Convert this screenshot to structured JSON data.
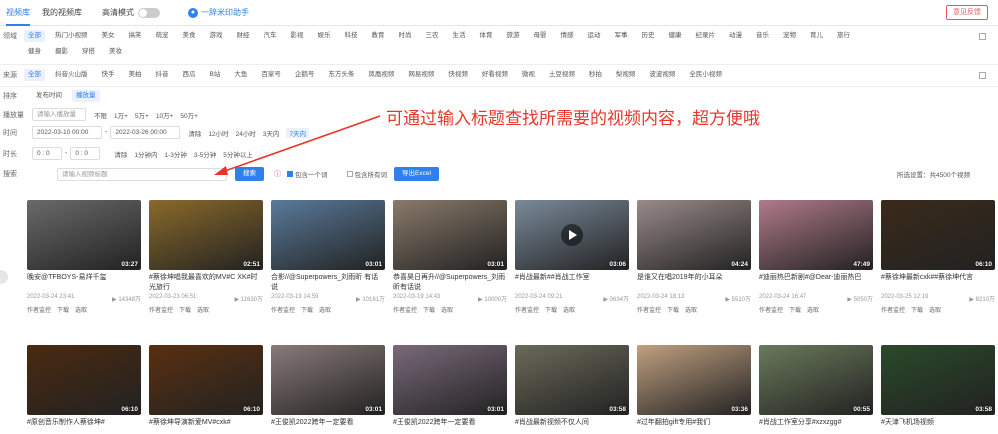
{
  "topbar": {
    "tabs": [
      "视频库",
      "我的视频库"
    ],
    "mode_label": "高清模式",
    "helper_label": "一辞米印助手",
    "feedback_label": "意见反馈"
  },
  "domain_row": {
    "label": "领域",
    "items": [
      "全部",
      "热门小视频",
      "美女",
      "搞笑",
      "萌宠",
      "美食",
      "游戏",
      "财经",
      "汽车",
      "影视",
      "娱乐",
      "科技",
      "教育",
      "时尚",
      "三农",
      "生活",
      "体育",
      "旅游",
      "母婴",
      "情感",
      "运动",
      "军事",
      "历史",
      "健康",
      "纪录片",
      "动漫",
      "音乐",
      "宠物",
      "育儿",
      "旅行"
    ]
  },
  "domain_row2": {
    "items": [
      "健身",
      "摄影",
      "穿搭",
      "美妆"
    ]
  },
  "source_row": {
    "label": "来源",
    "items": [
      "全部",
      "抖音火山版",
      "快手",
      "美拍",
      "抖音",
      "西瓜",
      "B站",
      "大鱼",
      "百家号",
      "企鹅号",
      "东方头条",
      "凤凰视频",
      "网易视频",
      "快视频",
      "好看视频",
      "微视",
      "土豆视频",
      "秒拍",
      "梨视频",
      "波波视频",
      "全民小视频"
    ]
  },
  "sort_row": {
    "label": "排序",
    "items": [
      "发布时间",
      "播放量"
    ]
  },
  "playcount_row": {
    "label": "播放量",
    "placeholder": "请输入播放量",
    "options": [
      "不限",
      "1万+",
      "5万+",
      "10万+",
      "50万+"
    ]
  },
  "time_row": {
    "label": "时间",
    "start": "2022-03-10 00:00",
    "end": "2022-03-26 00:00",
    "options": [
      "清除",
      "12小时",
      "24小时",
      "3天内",
      "7天内"
    ]
  },
  "duration_row": {
    "label": "时长",
    "start": "0 : 0",
    "end": "0 : 0",
    "options": [
      "清除",
      "1分钟内",
      "1-3分钟",
      "3-5分钟",
      "5分钟以上"
    ]
  },
  "search_row": {
    "label": "搜索",
    "placeholder": "请输入视频标题",
    "search_btn": "搜索",
    "opt1": "包含一个词",
    "opt2": "包含所有词",
    "export_btn": "导出Excel",
    "result_text": "所选设置：共4500个视频"
  },
  "callout": "可通过输入标题查找所需要的视频内容，超方便哦",
  "cards": [
    {
      "title": "晚安@TFBOYS-易烊千玺",
      "dur": "03:27",
      "plays": "14348万",
      "date": "2022-03-24 23:41",
      "bg": "#6a6a6a"
    },
    {
      "title": "#蔡徐坤唱我最喜欢的MV#C XK#时光旅行",
      "dur": "02:51",
      "plays": "11630万",
      "date": "2022-03-23 06:51",
      "bg": "#8a6a2a"
    },
    {
      "title": "合影//@Superpowers_刘雨昕 有话说",
      "dur": "03:01",
      "plays": "10181万",
      "date": "2022-03-19 14:59",
      "bg": "#5a7a9a"
    },
    {
      "title": "恭喜昊日再升//@Superpowers_刘雨昕有话说",
      "dur": "03:01",
      "plays": "10000万",
      "date": "2022-03-19 14:43",
      "bg": "#8a7a6a"
    },
    {
      "title": "#肖战最新##肖战工作室",
      "dur": "03:06",
      "plays": "0634万",
      "date": "2022-03-24 09:21",
      "bg": "#7a8a9a"
    },
    {
      "title": "是谁又在唱2019年的小耳朵",
      "dur": "04:24",
      "plays": "5510万",
      "date": "2022-03-24 18:13",
      "bg": "#9a8a8a"
    },
    {
      "title": "#迪丽热巴新剧#@Dear-迪丽热巴",
      "dur": "47:49",
      "plays": "5050万",
      "date": "2022-03-24 16:47",
      "bg": "#b07a8a"
    },
    {
      "title": "#蔡徐坤最新cxk##蔡徐坤代言",
      "dur": "06:10",
      "plays": "8210万",
      "date": "2022-03-25 12:19",
      "bg": "#3a2a1a"
    },
    {
      "title": "#原创音乐制作人蔡徐坤#",
      "dur": "06:10",
      "plays": "",
      "date": "",
      "bg": "#4a2a10"
    },
    {
      "title": "#蔡徐坤导演新爱MV#cxk#",
      "dur": "06:10",
      "plays": "",
      "date": "",
      "bg": "#5a3010"
    },
    {
      "title": "#王俊凯2022跨年一定要看",
      "dur": "03:01",
      "plays": "",
      "date": "",
      "bg": "#8a7a7a"
    },
    {
      "title": "#王俊凯2022跨年一定要看",
      "dur": "03:01",
      "plays": "",
      "date": "",
      "bg": "#7a6a7a"
    },
    {
      "title": "#肖战最新视频不仅人间",
      "dur": "03:58",
      "plays": "",
      "date": "",
      "bg": "#6a6a5a"
    },
    {
      "title": "#过年翻拍gift专用#我们",
      "dur": "03:36",
      "plays": "",
      "date": "",
      "bg": "#c0a080"
    },
    {
      "title": "#肖战工作室分享#xzxzgg#",
      "dur": "00:55",
      "plays": "",
      "date": "",
      "bg": "#6a7a5a"
    },
    {
      "title": "#天津飞机场视频",
      "dur": "03:58",
      "plays": "",
      "date": "",
      "bg": "#2a4a2a"
    }
  ],
  "card_actions": [
    "作者监控",
    "下载",
    "选取"
  ]
}
